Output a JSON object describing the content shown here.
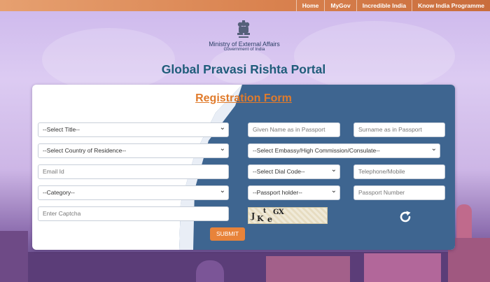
{
  "top_nav": [
    "Home",
    "MyGov",
    "Incredible India",
    "Know India Programme"
  ],
  "header": {
    "ministry": "Ministry of External Affairs",
    "government": "Government of India",
    "portal_title": "Global Pravasi Rishta Portal"
  },
  "form": {
    "title": "Registration Form",
    "select_title": "--Select Title--",
    "given_name_placeholder": "Given Name as in Passport",
    "surname_placeholder": "Surname as in Passport",
    "select_country": "--Select Country of Residence--",
    "select_embassy": "--Select Embassy/High Commission/Consulate--",
    "email_placeholder": "Email Id",
    "select_dial_code": "--Select Dial Code--",
    "telephone_placeholder": "Telephone/Mobile",
    "select_category": "--Category--",
    "select_passport_holder": "--Passport holder--",
    "passport_placeholder": "Passport Number",
    "captcha_placeholder": "Enter Captcha",
    "captcha_text": "JKteGX",
    "submit_label": "SUBMIT"
  },
  "colors": {
    "accent_orange": "#e07b2c",
    "title_teal": "#1f5c7a",
    "card_blue": "#3e6590"
  }
}
